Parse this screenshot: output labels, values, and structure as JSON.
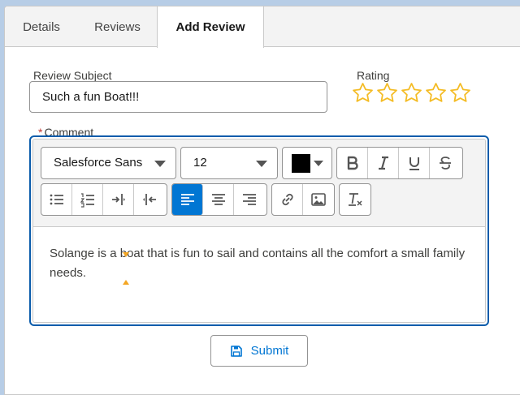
{
  "tabs": [
    {
      "label": "Details",
      "active": false
    },
    {
      "label": "Reviews",
      "active": false
    },
    {
      "label": "Add Review",
      "active": true
    }
  ],
  "form": {
    "subject_label": "Review Subject",
    "subject_value": "Such a fun Boat!!!",
    "rating_label": "Rating",
    "rating_value": 0,
    "rating_max": 5,
    "comment_required_mark": "*",
    "comment_label": "Comment"
  },
  "editor": {
    "font_family": "Salesforce Sans",
    "font_size": "12",
    "text_color": "#000000",
    "alignment_selected": "left",
    "content": "Solange is a boat that is fun to sail and contains all the comfort a small family needs."
  },
  "submit_label": "Submit",
  "colors": {
    "accent": "#0176d3",
    "focus_border": "#0b5cab",
    "star": "#f4bc25",
    "background": "#b7cde6"
  }
}
